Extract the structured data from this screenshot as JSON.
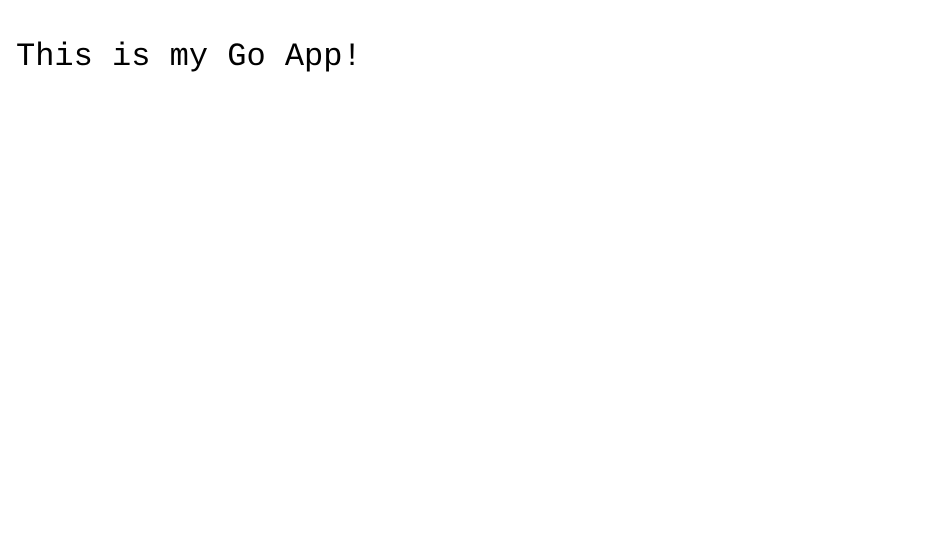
{
  "main": {
    "message": "This is my Go App!"
  }
}
